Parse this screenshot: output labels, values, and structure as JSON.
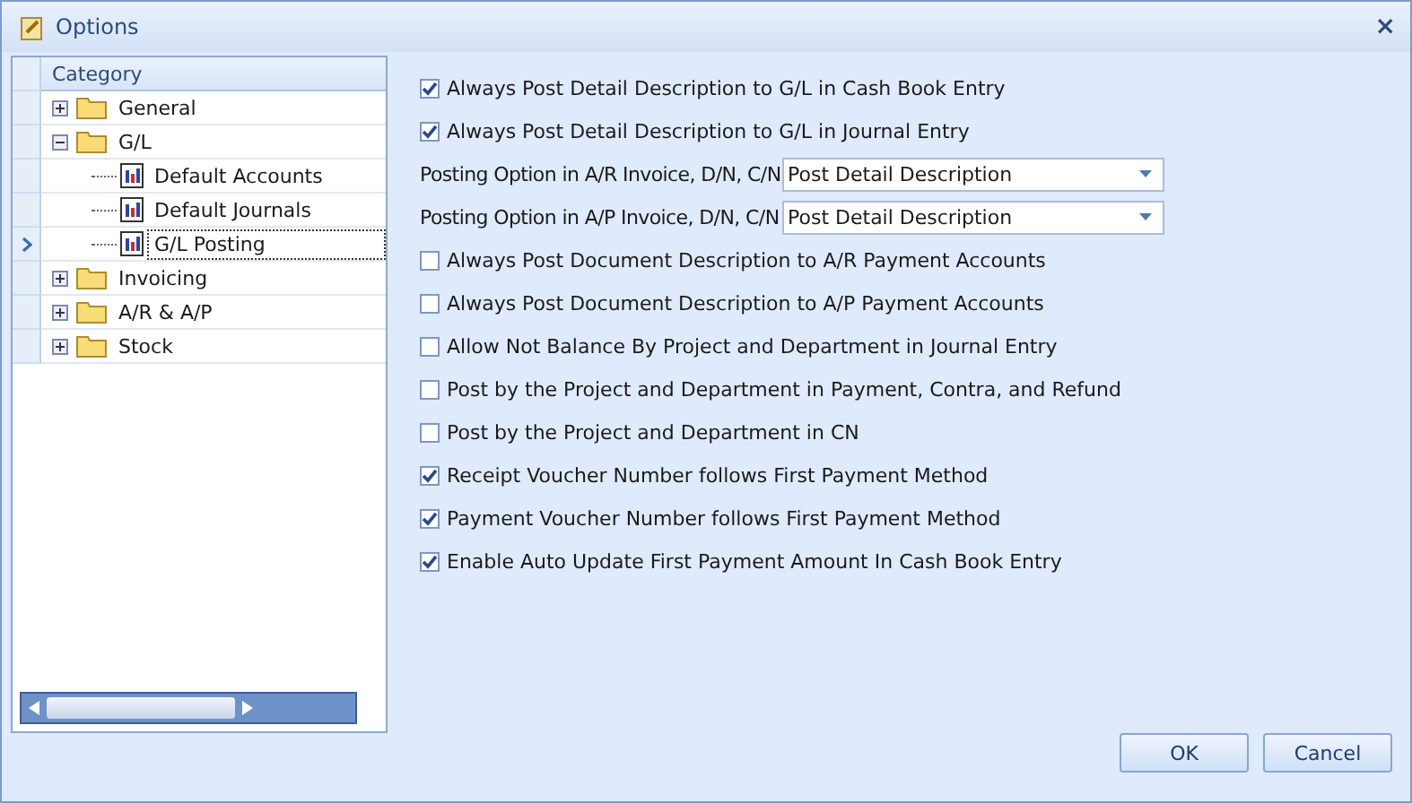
{
  "window": {
    "title": "Options",
    "close": "×"
  },
  "tree": {
    "header": "Category",
    "items": [
      {
        "label": "General",
        "expanded": false,
        "selected": false
      },
      {
        "label": "G/L",
        "expanded": true,
        "selected": false,
        "children": [
          {
            "label": "Default Accounts",
            "selected": false
          },
          {
            "label": "Default Journals",
            "selected": false
          },
          {
            "label": "G/L Posting",
            "selected": true
          }
        ]
      },
      {
        "label": "Invoicing",
        "expanded": false,
        "selected": false
      },
      {
        "label": "A/R & A/P",
        "expanded": false,
        "selected": false
      },
      {
        "label": "Stock",
        "expanded": false,
        "selected": false
      }
    ]
  },
  "options": [
    {
      "kind": "checkbox",
      "label": "Always Post Detail Description to G/L in Cash Book Entry",
      "checked": true
    },
    {
      "kind": "checkbox",
      "label": "Always Post Detail Description to G/L in Journal Entry",
      "checked": true
    },
    {
      "kind": "dropdown",
      "label": "Posting Option in A/R Invoice, D/N, C/N",
      "value": "Post Detail Description"
    },
    {
      "kind": "dropdown",
      "label": "Posting Option in A/P Invoice, D/N, C/N",
      "value": "Post Detail Description"
    },
    {
      "kind": "checkbox",
      "label": "Always Post Document Description to A/R Payment Accounts",
      "checked": false
    },
    {
      "kind": "checkbox",
      "label": "Always Post Document Description to A/P Payment Accounts",
      "checked": false
    },
    {
      "kind": "checkbox",
      "label": "Allow Not Balance By Project and Department in Journal Entry",
      "checked": false
    },
    {
      "kind": "checkbox",
      "label": "Post by the Project and Department in Payment, Contra, and Refund",
      "checked": false
    },
    {
      "kind": "checkbox",
      "label": "Post by the Project and Department in CN",
      "checked": false
    },
    {
      "kind": "checkbox",
      "label": "Receipt Voucher Number follows First Payment Method",
      "checked": true
    },
    {
      "kind": "checkbox",
      "label": "Payment Voucher Number follows First Payment Method",
      "checked": true
    },
    {
      "kind": "checkbox",
      "label": "Enable Auto Update First Payment Amount In Cash Book Entry",
      "checked": true
    }
  ],
  "buttons": [
    "OK",
    "Cancel"
  ]
}
